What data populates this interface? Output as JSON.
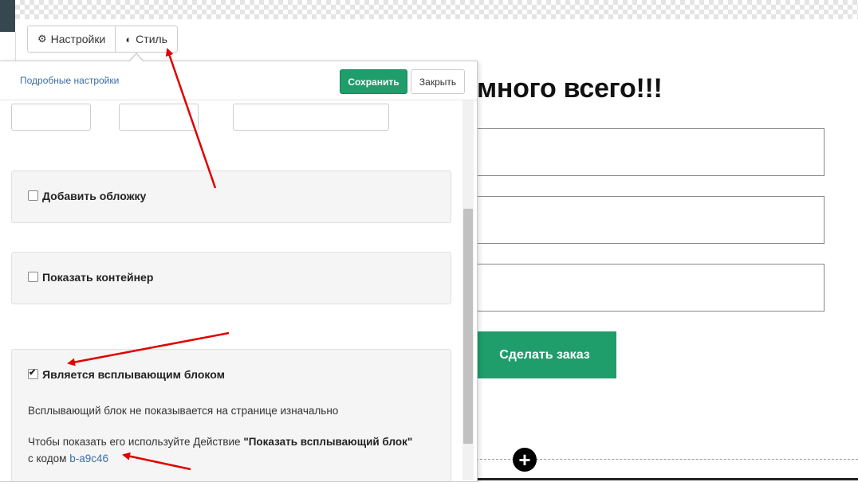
{
  "page": {
    "heading": "много всего!!!",
    "order_button": "Сделать заказ",
    "add_block": "+"
  },
  "tabs": {
    "settings_label": "Настройки",
    "style_label": "Стиль"
  },
  "panel": {
    "advanced_link": "Подробные настройки",
    "save_label": "Сохранить",
    "close_label": "Закрыть",
    "cover_label": "Добавить обложку",
    "container_label": "Показать контейнер",
    "popup_label": "Является всплывающим блоком",
    "popup_note": "Всплывающий блок не показывается на странице изначально",
    "popup_hint_prefix": "Чтобы показать его используйте Действие",
    "popup_hint_action": "\"Показать всплывающий блок\"",
    "popup_code_prefix": "с кодом",
    "popup_code": "b-a9c46",
    "cover_checked": false,
    "container_checked": false,
    "popup_checked": true
  },
  "colors": {
    "accent_green": "#1f9d6b",
    "link_blue": "#3a6ea5",
    "annotation_red": "#e00000"
  },
  "icons": {
    "settings": "gear-icon",
    "style": "contrast-icon",
    "add": "plus-circle-icon"
  }
}
